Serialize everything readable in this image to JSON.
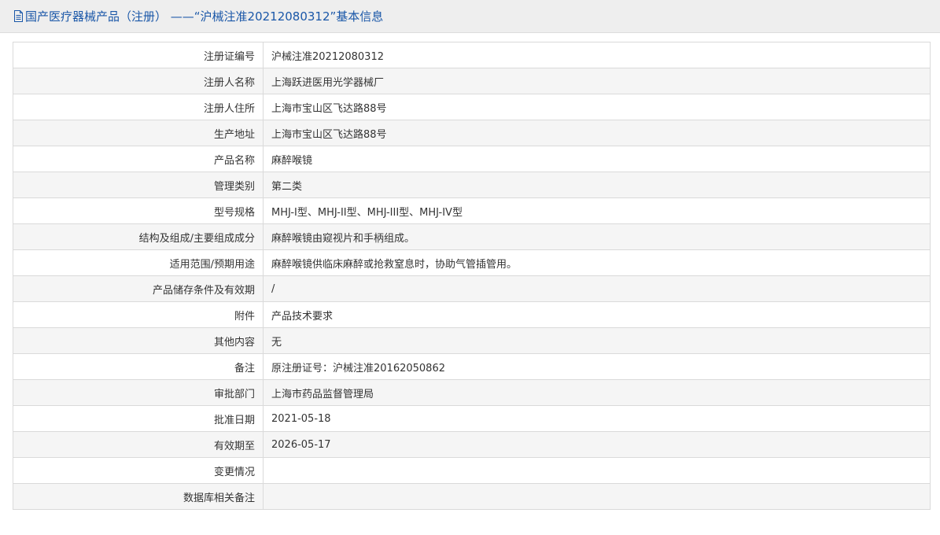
{
  "header": {
    "title": "国产医疗器械产品（注册） ——“沪械注准20212080312”基本信息",
    "icon": "document-icon",
    "title_color": "#1a57a8"
  },
  "rows": [
    {
      "label": "注册证编号",
      "value": "沪械注准20212080312"
    },
    {
      "label": "注册人名称",
      "value": "上海跃进医用光学器械厂"
    },
    {
      "label": "注册人住所",
      "value": "上海市宝山区飞达路88号"
    },
    {
      "label": "生产地址",
      "value": "上海市宝山区飞达路88号"
    },
    {
      "label": "产品名称",
      "value": "麻醉喉镜"
    },
    {
      "label": "管理类别",
      "value": "第二类"
    },
    {
      "label": "型号规格",
      "value": "MHJ-I型、MHJ-II型、MHJ-III型、MHJ-IV型"
    },
    {
      "label": "结构及组成/主要组成成分",
      "value": "麻醉喉镜由窥视片和手柄组成。"
    },
    {
      "label": "适用范围/预期用途",
      "value": "麻醉喉镜供临床麻醉或抢救窒息时，协助气管插管用。"
    },
    {
      "label": "产品储存条件及有效期",
      "value": "/"
    },
    {
      "label": "附件",
      "value": "产品技术要求"
    },
    {
      "label": "其他内容",
      "value": "无"
    },
    {
      "label": "备注",
      "value": "原注册证号：沪械注准20162050862"
    },
    {
      "label": "审批部门",
      "value": "上海市药品监督管理局"
    },
    {
      "label": "批准日期",
      "value": "2021-05-18"
    },
    {
      "label": "有效期至",
      "value": "2026-05-17"
    },
    {
      "label": "变更情况",
      "value": ""
    },
    {
      "label": "数据库相关备注",
      "value": ""
    }
  ]
}
